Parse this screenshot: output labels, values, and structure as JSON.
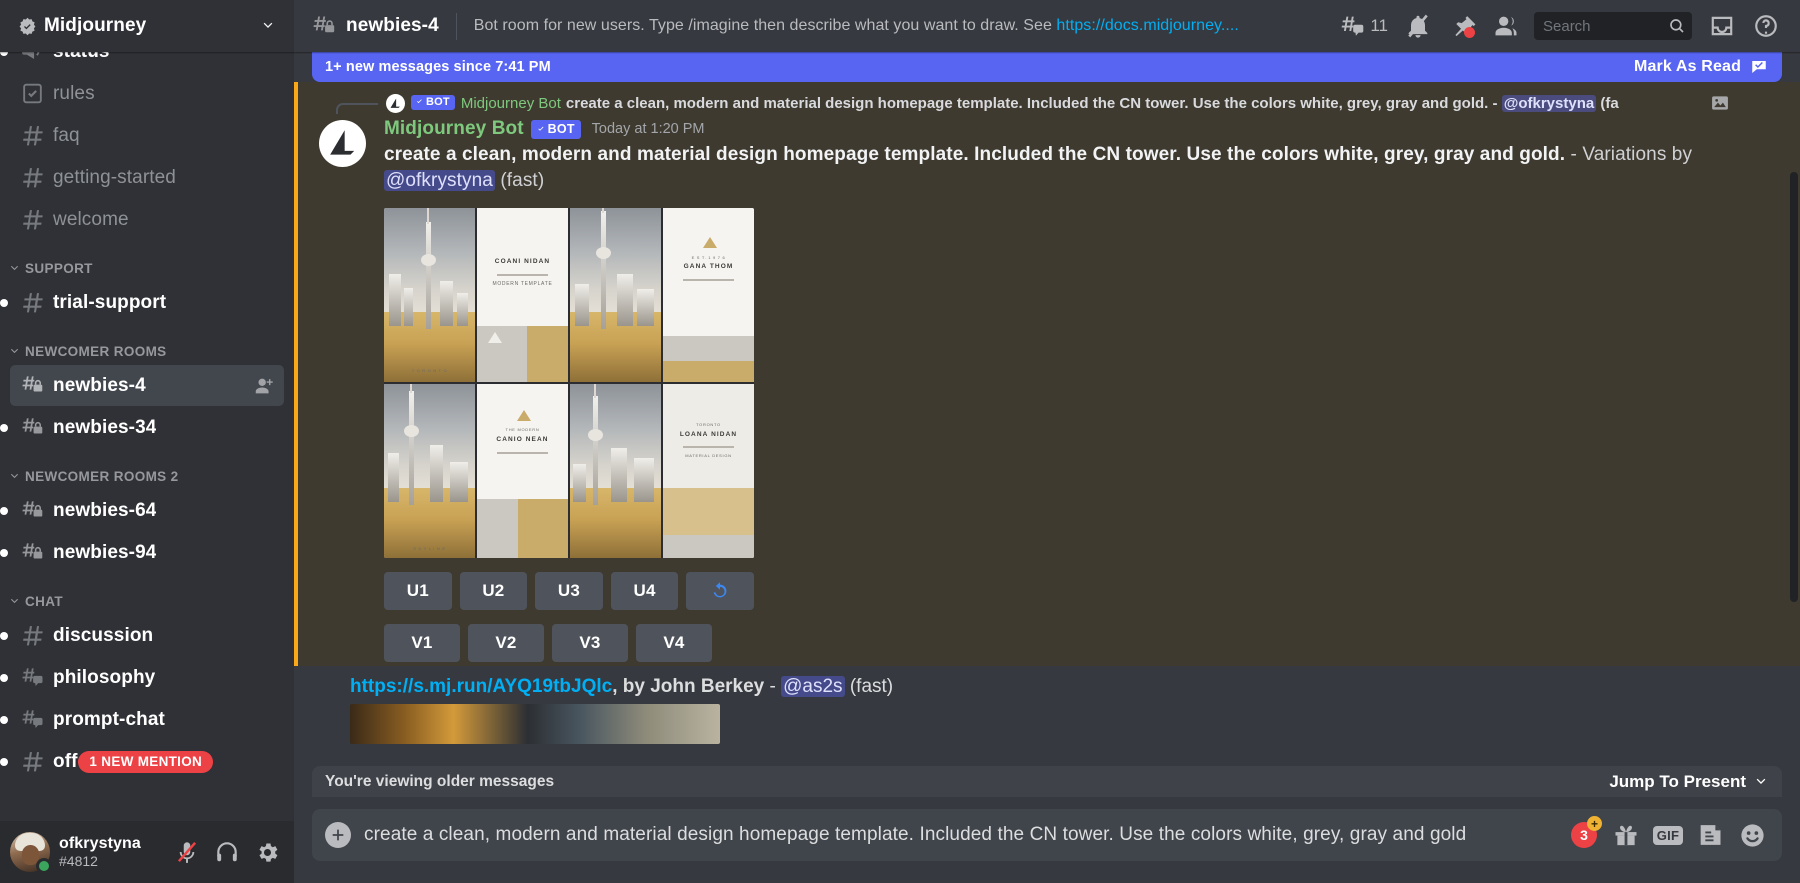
{
  "server": {
    "name": "Midjourney",
    "verified_icon": "verified-badge-icon",
    "chevron_icon": "chevron-down-icon"
  },
  "sidebar": {
    "groups": [
      {
        "label": "",
        "channels": [
          {
            "name": "status",
            "icon": "announcement-channel-icon",
            "unread": true,
            "active": false,
            "partial": true
          },
          {
            "name": "rules",
            "icon": "rules-channel-icon",
            "unread": false,
            "active": false
          },
          {
            "name": "faq",
            "icon": "text-channel-icon",
            "unread": false,
            "active": false
          },
          {
            "name": "getting-started",
            "icon": "text-channel-icon",
            "unread": false,
            "active": false
          },
          {
            "name": "welcome",
            "icon": "text-channel-icon",
            "unread": false,
            "active": false
          }
        ]
      },
      {
        "label": "SUPPORT",
        "channels": [
          {
            "name": "trial-support",
            "icon": "text-channel-icon",
            "unread": true,
            "active": false
          }
        ]
      },
      {
        "label": "NEWCOMER ROOMS",
        "channels": [
          {
            "name": "newbies-4",
            "icon": "private-thread-channel-icon",
            "unread": false,
            "active": true,
            "trailing_icon": "add-member-icon"
          },
          {
            "name": "newbies-34",
            "icon": "private-thread-channel-icon",
            "unread": true,
            "active": false
          }
        ]
      },
      {
        "label": "NEWCOMER ROOMS 2",
        "channels": [
          {
            "name": "newbies-64",
            "icon": "private-thread-channel-icon",
            "unread": true,
            "active": false
          },
          {
            "name": "newbies-94",
            "icon": "private-thread-channel-icon",
            "unread": true,
            "active": false
          }
        ]
      },
      {
        "label": "CHAT",
        "channels": [
          {
            "name": "discussion",
            "icon": "text-channel-icon",
            "unread": true,
            "active": false
          },
          {
            "name": "philosophy",
            "icon": "thread-channel-icon",
            "unread": true,
            "active": false
          },
          {
            "name": "prompt-chat",
            "icon": "thread-channel-icon",
            "unread": true,
            "active": false
          },
          {
            "name": "off-t",
            "icon": "text-channel-icon",
            "unread": true,
            "active": false,
            "mention_badge": "1 NEW MENTION"
          }
        ]
      }
    ]
  },
  "user_panel": {
    "username": "ofkrystyna",
    "discriminator": "#4812",
    "status": "online",
    "buttons": [
      {
        "icon": "mic-muted-icon",
        "name": "toggle-mute-button"
      },
      {
        "icon": "headset-icon",
        "name": "toggle-deafen-button"
      },
      {
        "icon": "gear-icon",
        "name": "user-settings-button"
      }
    ]
  },
  "topbar": {
    "channel_name": "newbies-4",
    "channel_icon": "private-thread-channel-icon",
    "topic_prefix": "Bot room for new users. Type /imagine then describe what you want to draw. See ",
    "topic_link": "https://docs.midjourney....",
    "threads_count": "11",
    "icons": [
      {
        "name": "threads-icon",
        "label": "11"
      },
      {
        "name": "notifications-off-icon"
      },
      {
        "name": "pinned-messages-icon",
        "badge": true
      },
      {
        "name": "member-list-icon"
      }
    ],
    "search_placeholder": "Search",
    "search_icon": "search-icon",
    "inbox_icon": "inbox-icon",
    "help_icon": "help-icon"
  },
  "new_messages_bar": {
    "text": "1+ new messages since 7:41 PM",
    "action": "Mark As Read",
    "action_icon": "mark-read-icon"
  },
  "message": {
    "reply_reference": {
      "bot_tag": "BOT",
      "author": "Midjourney Bot",
      "text_bold": "create a clean, modern and material design homepage template. Included the CN tower. Use the colors white, grey, gray and gold.",
      "dash": " - ",
      "mention": "@ofkrystyna",
      "suffix": " (fa",
      "attachment_icon": "image-attachment-icon"
    },
    "author": "Midjourney Bot",
    "bot_tag": "BOT",
    "timestamp": "Today at 1:20 PM",
    "prompt_bold": "create a clean, modern and material design homepage template. Included the CN tower. Use the colors white, grey, gray and gold.",
    "variations_text": " - Variations by ",
    "mention": "@ofkrystyna",
    "speed": " (fast)",
    "upscale_buttons": [
      "U1",
      "U2",
      "U3",
      "U4"
    ],
    "reroll_button_icon": "reroll-icon",
    "variation_buttons": [
      "V1",
      "V2",
      "V3",
      "V4"
    ],
    "image_grid": {
      "alt": "four-panel midjourney grid of CN tower homepage templates",
      "panels": [
        {
          "headline": "COANI NIDAN"
        },
        {
          "headline": "GANA THOM"
        },
        {
          "headline": "CANIO NEAN"
        },
        {
          "headline": "LOANA NIDAN"
        }
      ]
    }
  },
  "next_message": {
    "link": "https://s.mj.run/AYQ19tbJQlc",
    "by": ", by John Berkey",
    "dash": " - ",
    "mention": "@as2s",
    "speed": " (fast)"
  },
  "jump_bar": {
    "text": "You're viewing older messages",
    "action": "Jump To Present",
    "chevron_icon": "chevron-down-icon"
  },
  "composer": {
    "value": "create a clean, modern and material design homepage template. Included the CN tower. Use the colors white, grey, gray and gold",
    "spellcheck_words": [
      "and",
      "Included",
      "and"
    ],
    "add_icon": "plus-icon",
    "nitro_count": "3",
    "nitro_plus": "+",
    "gift_icon": "gift-icon",
    "gif_label": "GIF",
    "sticker_icon": "sticker-icon",
    "emoji_icon": "emoji-icon"
  },
  "colors": {
    "brand_blurple": "#5865f2",
    "sidebar_bg": "#2f3136",
    "main_bg": "#36393f",
    "mention_bg": "#3f3a2f",
    "mention_bar": "#faa81a",
    "danger_red": "#ed4245",
    "link_blue": "#00aff4",
    "bot_green": "#7ec97e"
  }
}
